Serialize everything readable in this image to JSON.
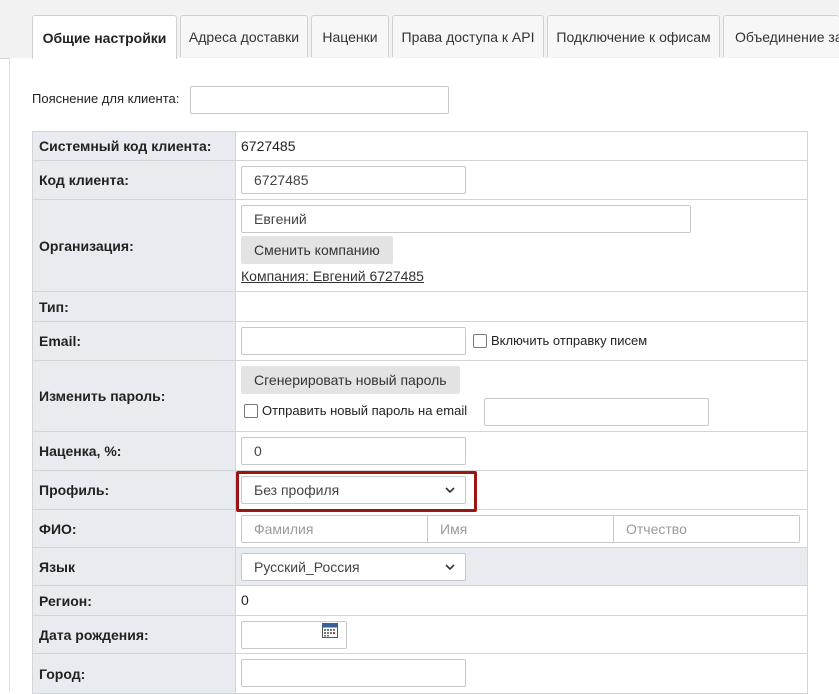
{
  "tabs": [
    {
      "label": "Общие настройки",
      "active": true
    },
    {
      "label": "Адреса доставки"
    },
    {
      "label": "Наценки"
    },
    {
      "label": "Права доступа к API"
    },
    {
      "label": "Подключение к офисам"
    },
    {
      "label": "Объединение за"
    }
  ],
  "client_hint": {
    "label": "Пояснение для клиента:",
    "value": ""
  },
  "rows": {
    "system_code": {
      "label": "Системный код клиента:",
      "value": "6727485"
    },
    "client_code": {
      "label": "Код клиента:",
      "value": "6727485"
    },
    "organization": {
      "label": "Организация:",
      "value": "Евгений",
      "change_button": "Сменить компанию",
      "company_link": "Компания: Евгений 6727485"
    },
    "type": {
      "label": "Тип:"
    },
    "email": {
      "label": "Email:",
      "value": "",
      "enable_mail_label": "Включить отправку писем"
    },
    "password": {
      "label": "Изменить пароль:",
      "generate_button": "Сгенерировать новый пароль",
      "send_label": "Отправить новый пароль на email",
      "email_value": ""
    },
    "markup": {
      "label": "Наценка, %:",
      "value": "0"
    },
    "profile": {
      "label": "Профиль:",
      "selected": "Без профиля"
    },
    "fio": {
      "label": "ФИО:",
      "last_name_placeholder": "Фамилия",
      "first_name_placeholder": "Имя",
      "middle_name_placeholder": "Отчество"
    },
    "language": {
      "label": "Язык",
      "selected": "Русский_Россия"
    },
    "region": {
      "label": "Регион:",
      "value": "0"
    },
    "birth_date": {
      "label": "Дата рождения:",
      "value": ""
    },
    "city": {
      "label": "Город:",
      "value": ""
    }
  },
  "icons": {
    "select_chevron": "chevron-down-icon",
    "calendar": "calendar-icon"
  },
  "colors": {
    "highlight": "#9b1515",
    "label_bg": "#e8ecf0"
  }
}
